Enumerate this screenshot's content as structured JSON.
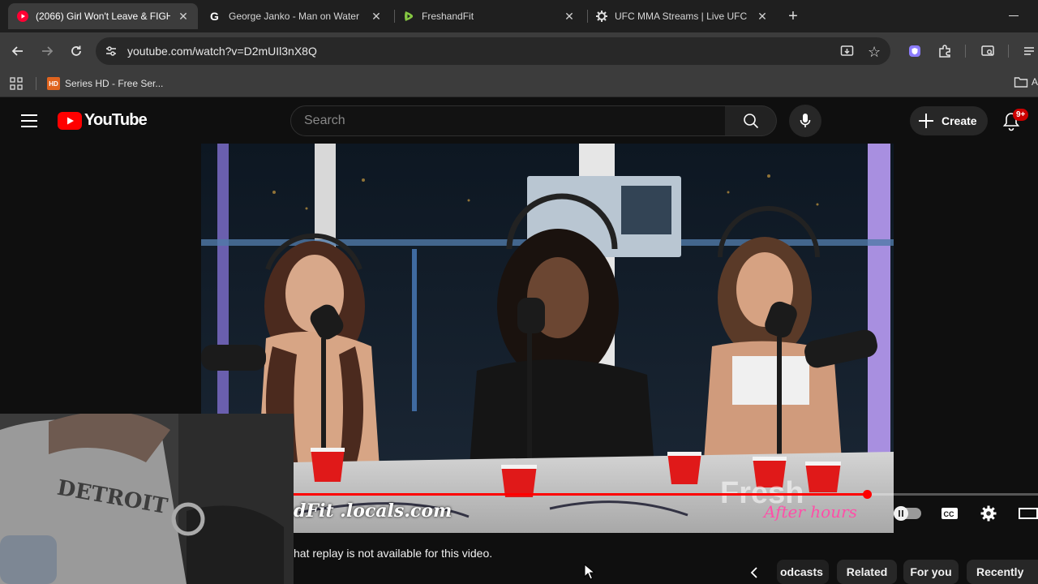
{
  "browser": {
    "tabs": [
      {
        "title": "(2066) Girl Won't Leave & FIGH",
        "favicon": "youtube-icon",
        "active": true
      },
      {
        "title": "George Janko - Man on Water",
        "favicon": "g-icon",
        "active": false
      },
      {
        "title": "FreshandFit",
        "favicon": "rumble-icon",
        "active": false
      },
      {
        "title": "UFC MMA Streams | Live UFC O",
        "favicon": "gear-icon",
        "active": false
      }
    ],
    "close_glyph": "✕",
    "new_tab_glyph": "+",
    "url": "youtube.com/watch?v=D2mUIl3nX8Q",
    "bookmarks": [
      {
        "label": "Series HD - Free Ser...",
        "icon_text": "HD"
      },
      {
        "label": "A",
        "icon_text": ""
      }
    ]
  },
  "youtube": {
    "logo_text": "YouTube",
    "search_placeholder": "Search",
    "create_label": "Create",
    "notification_count": "9+"
  },
  "video": {
    "watermark_left": "dFit .locals.com",
    "watermark_right": "Fresh",
    "watermark_sub": "After hours",
    "progress": 0.77
  },
  "chat_notice": "hat replay is not available for this video.",
  "chips": [
    "odcasts",
    "Related",
    "For you",
    "Recently"
  ],
  "colors": {
    "yt_red": "#ff0000",
    "accent_purple": "#8c7cff"
  }
}
